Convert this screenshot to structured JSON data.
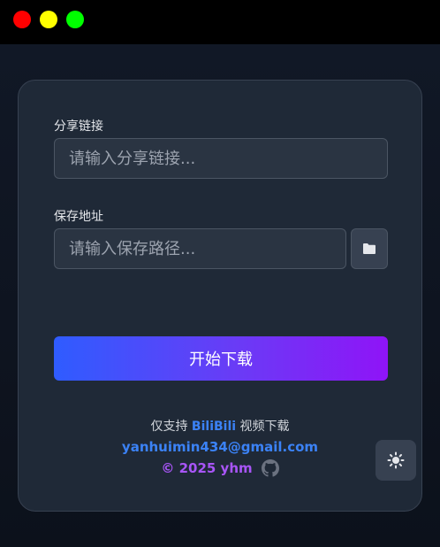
{
  "window": {
    "controls": [
      "close",
      "minimize",
      "maximize"
    ],
    "colors": {
      "close": "#ff0000",
      "minimize": "#ffff00",
      "maximize": "#00ff00"
    }
  },
  "form": {
    "share_link": {
      "label": "分享链接",
      "placeholder": "请输入分享链接...",
      "value": ""
    },
    "save_path": {
      "label": "保存地址",
      "placeholder": "请输入保存路径...",
      "value": "",
      "browse_icon": "folder-icon"
    },
    "start_button": "开始下载"
  },
  "footer": {
    "support_prefix": "仅支持 ",
    "support_brand": "BiliBili",
    "support_suffix": " 视频下载",
    "email": "yanhuimin434@gmail.com",
    "copyright": "© 2025 yhm",
    "repo_icon": "github-icon"
  },
  "theme_toggle_icon": "sun-icon",
  "colors": {
    "accent_blue": "#3b82f6",
    "accent_purple": "#a855f7",
    "gradient_start": "#2f5cff",
    "gradient_end": "#8f14f7"
  }
}
